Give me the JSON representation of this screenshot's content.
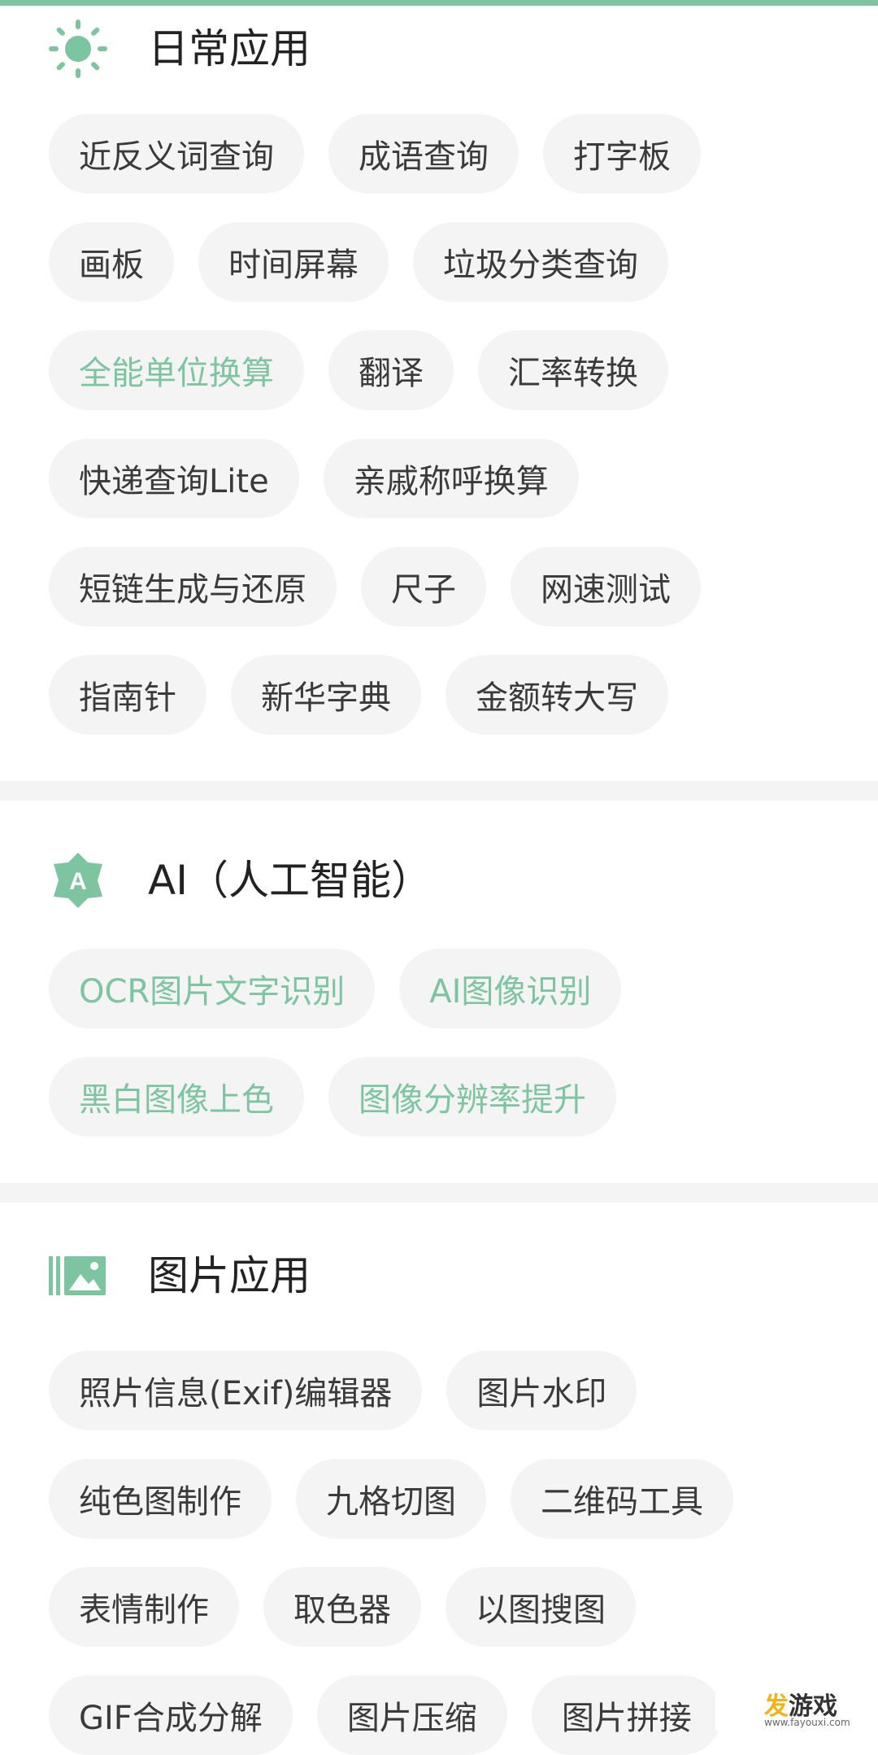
{
  "colors": {
    "accent": "#7DC4A0",
    "chip_bg": "#F4F4F4",
    "divider": "#F4F4F4"
  },
  "sections": [
    {
      "icon": "sun-icon",
      "title": "日常应用",
      "rows": [
        [
          {
            "label": "近反义词查询"
          },
          {
            "label": "成语查询"
          },
          {
            "label": "打字板"
          }
        ],
        [
          {
            "label": "画板"
          },
          {
            "label": "时间屏幕"
          },
          {
            "label": "垃圾分类查询"
          }
        ],
        [
          {
            "label": "全能单位换算",
            "accent": true
          },
          {
            "label": "翻译"
          },
          {
            "label": "汇率转换"
          }
        ],
        [
          {
            "label": "快递查询Lite"
          },
          {
            "label": "亲戚称呼换算"
          }
        ],
        [
          {
            "label": "短链生成与还原"
          },
          {
            "label": "尺子"
          },
          {
            "label": "网速测试"
          }
        ],
        [
          {
            "label": "指南针"
          },
          {
            "label": "新华字典"
          },
          {
            "label": "金额转大写"
          }
        ]
      ]
    },
    {
      "icon": "ai-badge-icon",
      "icon_letter": "A",
      "title": "AI（人工智能）",
      "rows": [
        [
          {
            "label": "OCR图片文字识别",
            "accent": true
          },
          {
            "label": "AI图像识别",
            "accent": true
          }
        ],
        [
          {
            "label": "黑白图像上色",
            "accent": true
          },
          {
            "label": "图像分辨率提升",
            "accent": true
          }
        ]
      ]
    },
    {
      "icon": "image-icon",
      "title": "图片应用",
      "rows": [
        [
          {
            "label": "照片信息(Exif)编辑器"
          },
          {
            "label": "图片水印"
          }
        ],
        [
          {
            "label": "纯色图制作"
          },
          {
            "label": "九格切图"
          },
          {
            "label": "二维码工具"
          }
        ],
        [
          {
            "label": "表情制作"
          },
          {
            "label": "取色器"
          },
          {
            "label": "以图搜图"
          }
        ],
        [
          {
            "label": "GIF合成分解"
          },
          {
            "label": "图片压缩"
          },
          {
            "label": "图片拼接"
          }
        ]
      ]
    }
  ],
  "watermark": {
    "text_accent": "发",
    "text_rest": "游戏",
    "url": "www.fayouxi.com"
  }
}
